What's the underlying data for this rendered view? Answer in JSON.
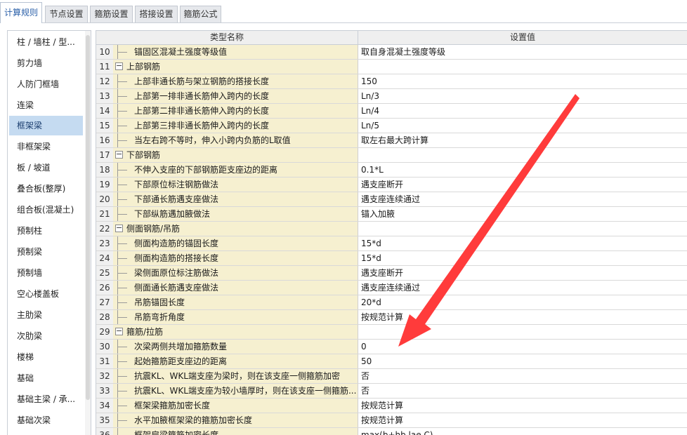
{
  "tabs": [
    {
      "label": "计算规则",
      "active": true
    },
    {
      "label": "节点设置",
      "active": false
    },
    {
      "label": "箍筋设置",
      "active": false
    },
    {
      "label": "搭接设置",
      "active": false
    },
    {
      "label": "箍筋公式",
      "active": false
    }
  ],
  "sidebar": {
    "selected": "框架梁",
    "items": [
      {
        "label": "柱 / 墙柱 / 型..."
      },
      {
        "label": "剪力墙"
      },
      {
        "label": "人防门框墙"
      },
      {
        "label": "连梁"
      },
      {
        "label": "框架梁"
      },
      {
        "label": "非框架梁"
      },
      {
        "label": "板 / 坡道"
      },
      {
        "label": "叠合板(整厚)"
      },
      {
        "label": "组合板(混凝土)"
      },
      {
        "label": "预制柱"
      },
      {
        "label": "预制梁"
      },
      {
        "label": "预制墙"
      },
      {
        "label": "空心楼盖板"
      },
      {
        "label": "主肋梁"
      },
      {
        "label": "次肋梁"
      },
      {
        "label": "楼梯"
      },
      {
        "label": "基础"
      },
      {
        "label": "基础主梁 / 承..."
      },
      {
        "label": "基础次梁"
      }
    ]
  },
  "grid": {
    "headers": {
      "name": "类型名称",
      "value": "设置值"
    },
    "rows": [
      {
        "num": "10",
        "type": "item",
        "name": "锚固区混凝土强度等级值",
        "value": "取自身混凝土强度等级"
      },
      {
        "num": "11",
        "type": "group",
        "toggle": "−",
        "name": "上部钢筋",
        "value": ""
      },
      {
        "num": "12",
        "type": "item",
        "name": "上部非通长筋与架立钢筋的搭接长度",
        "value": "150"
      },
      {
        "num": "13",
        "type": "item",
        "name": "上部第一排非通长筋伸入跨内的长度",
        "value": "Ln/3"
      },
      {
        "num": "14",
        "type": "item",
        "name": "上部第二排非通长筋伸入跨内的长度",
        "value": "Ln/4"
      },
      {
        "num": "15",
        "type": "item",
        "name": "上部第三排非通长筋伸入跨内的长度",
        "value": "Ln/5"
      },
      {
        "num": "16",
        "type": "item",
        "name": "当左右跨不等时，伸入小跨内负筋的L取值",
        "value": "取左右最大跨计算"
      },
      {
        "num": "17",
        "type": "group",
        "toggle": "−",
        "name": "下部钢筋",
        "value": ""
      },
      {
        "num": "18",
        "type": "item",
        "name": "不伸入支座的下部钢筋距支座边的距离",
        "value": "0.1*L"
      },
      {
        "num": "19",
        "type": "item",
        "name": "下部原位标注钢筋做法",
        "value": "遇支座断开"
      },
      {
        "num": "20",
        "type": "item",
        "name": "下部通长筋遇支座做法",
        "value": "遇支座连续通过"
      },
      {
        "num": "21",
        "type": "item",
        "name": "下部纵筋遇加腋做法",
        "value": "锚入加腋"
      },
      {
        "num": "22",
        "type": "group",
        "toggle": "−",
        "name": "侧面钢筋/吊筋",
        "value": ""
      },
      {
        "num": "23",
        "type": "item",
        "name": "侧面构造筋的锚固长度",
        "value": "15*d"
      },
      {
        "num": "24",
        "type": "item",
        "name": "侧面构造筋的搭接长度",
        "value": "15*d"
      },
      {
        "num": "25",
        "type": "item",
        "name": "梁侧面原位标注筋做法",
        "value": "遇支座断开"
      },
      {
        "num": "26",
        "type": "item",
        "name": "侧面通长筋遇支座做法",
        "value": "遇支座连续通过"
      },
      {
        "num": "27",
        "type": "item",
        "name": "吊筋锚固长度",
        "value": "20*d"
      },
      {
        "num": "28",
        "type": "item",
        "name": "吊筋弯折角度",
        "value": "按规范计算"
      },
      {
        "num": "29",
        "type": "group",
        "toggle": "−",
        "name": "箍筋/拉筋",
        "value": ""
      },
      {
        "num": "30",
        "type": "item",
        "name": "次梁两侧共增加箍筋数量",
        "value": "0"
      },
      {
        "num": "31",
        "type": "item",
        "name": "起始箍筋距支座边的距离",
        "value": "50"
      },
      {
        "num": "32",
        "type": "item",
        "name": "抗震KL、WKL端支座为梁时，则在该支座一侧箍筋加密",
        "value": "否"
      },
      {
        "num": "33",
        "type": "item",
        "name": "抗震KL、WKL端支座为较小墙厚时，则在该支座一侧箍筋...",
        "value": "否"
      },
      {
        "num": "34",
        "type": "item",
        "name": "框架梁箍筋加密长度",
        "value": "按规范计算"
      },
      {
        "num": "35",
        "type": "item",
        "name": "水平加腋框架梁的箍筋加密长度",
        "value": "按规范计算"
      },
      {
        "num": "36",
        "type": "item",
        "name": "框架扁梁箍筋加密长度",
        "value": "max(b+hb,lae,C)"
      }
    ]
  },
  "colors": {
    "name_cell_bg": "#f6f0d0",
    "selected_sidebar_bg": "#c5dbf1",
    "active_tab_text": "#2a5fa8",
    "arrow": "#ff3b3b"
  }
}
